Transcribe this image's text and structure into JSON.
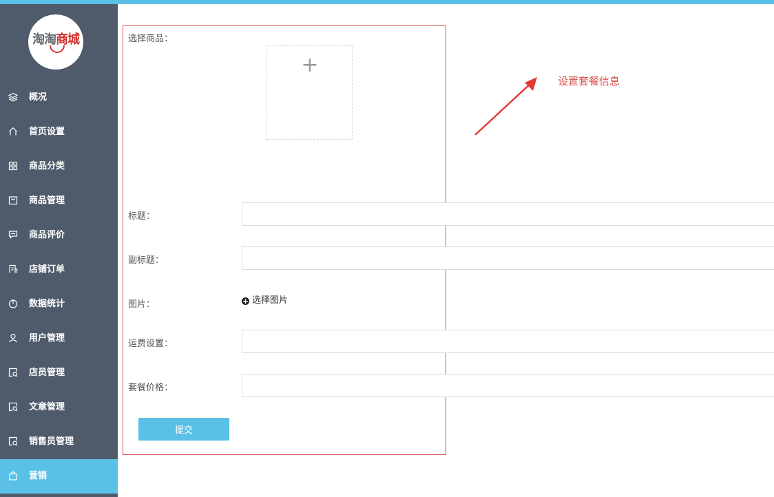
{
  "brand": {
    "logo_text_a": "淘淘",
    "logo_text_b": "商城"
  },
  "sidebar": {
    "items": [
      {
        "label": "概况",
        "icon": "layers-icon"
      },
      {
        "label": "首页设置",
        "icon": "home-icon"
      },
      {
        "label": "商品分类",
        "icon": "grid-icon"
      },
      {
        "label": "商品管理",
        "icon": "bag-icon"
      },
      {
        "label": "商品评价",
        "icon": "comment-icon"
      },
      {
        "label": "店铺订单",
        "icon": "order-icon"
      },
      {
        "label": "数据统计",
        "icon": "power-icon"
      },
      {
        "label": "用户管理",
        "icon": "user-icon"
      },
      {
        "label": "店员管理",
        "icon": "staff-icon"
      },
      {
        "label": "文章管理",
        "icon": "article-icon"
      },
      {
        "label": "销售员管理",
        "icon": "sales-icon"
      },
      {
        "label": "营销",
        "icon": "shopping-bag-icon",
        "active": true
      }
    ],
    "active_color": "#5bc0e6",
    "background": "#4f5b6b"
  },
  "form": {
    "select_product_label": "选择商品：",
    "upload_plus": "+",
    "title_label": "标题：",
    "title_value": "",
    "subtitle_label": "副标题：",
    "subtitle_value": "",
    "image_label": "图片：",
    "image_picker_icon": "+",
    "image_picker_text": "选择图片",
    "shipping_label": "运费设置：",
    "shipping_value": "",
    "price_label": "套餐价格：",
    "price_value": "",
    "submit_label": "提交"
  },
  "annotation": {
    "text": "设置套餐信息",
    "color": "#d9534f"
  },
  "colors": {
    "accent": "#5bc0e6",
    "highlight_box": "#d9534f"
  }
}
